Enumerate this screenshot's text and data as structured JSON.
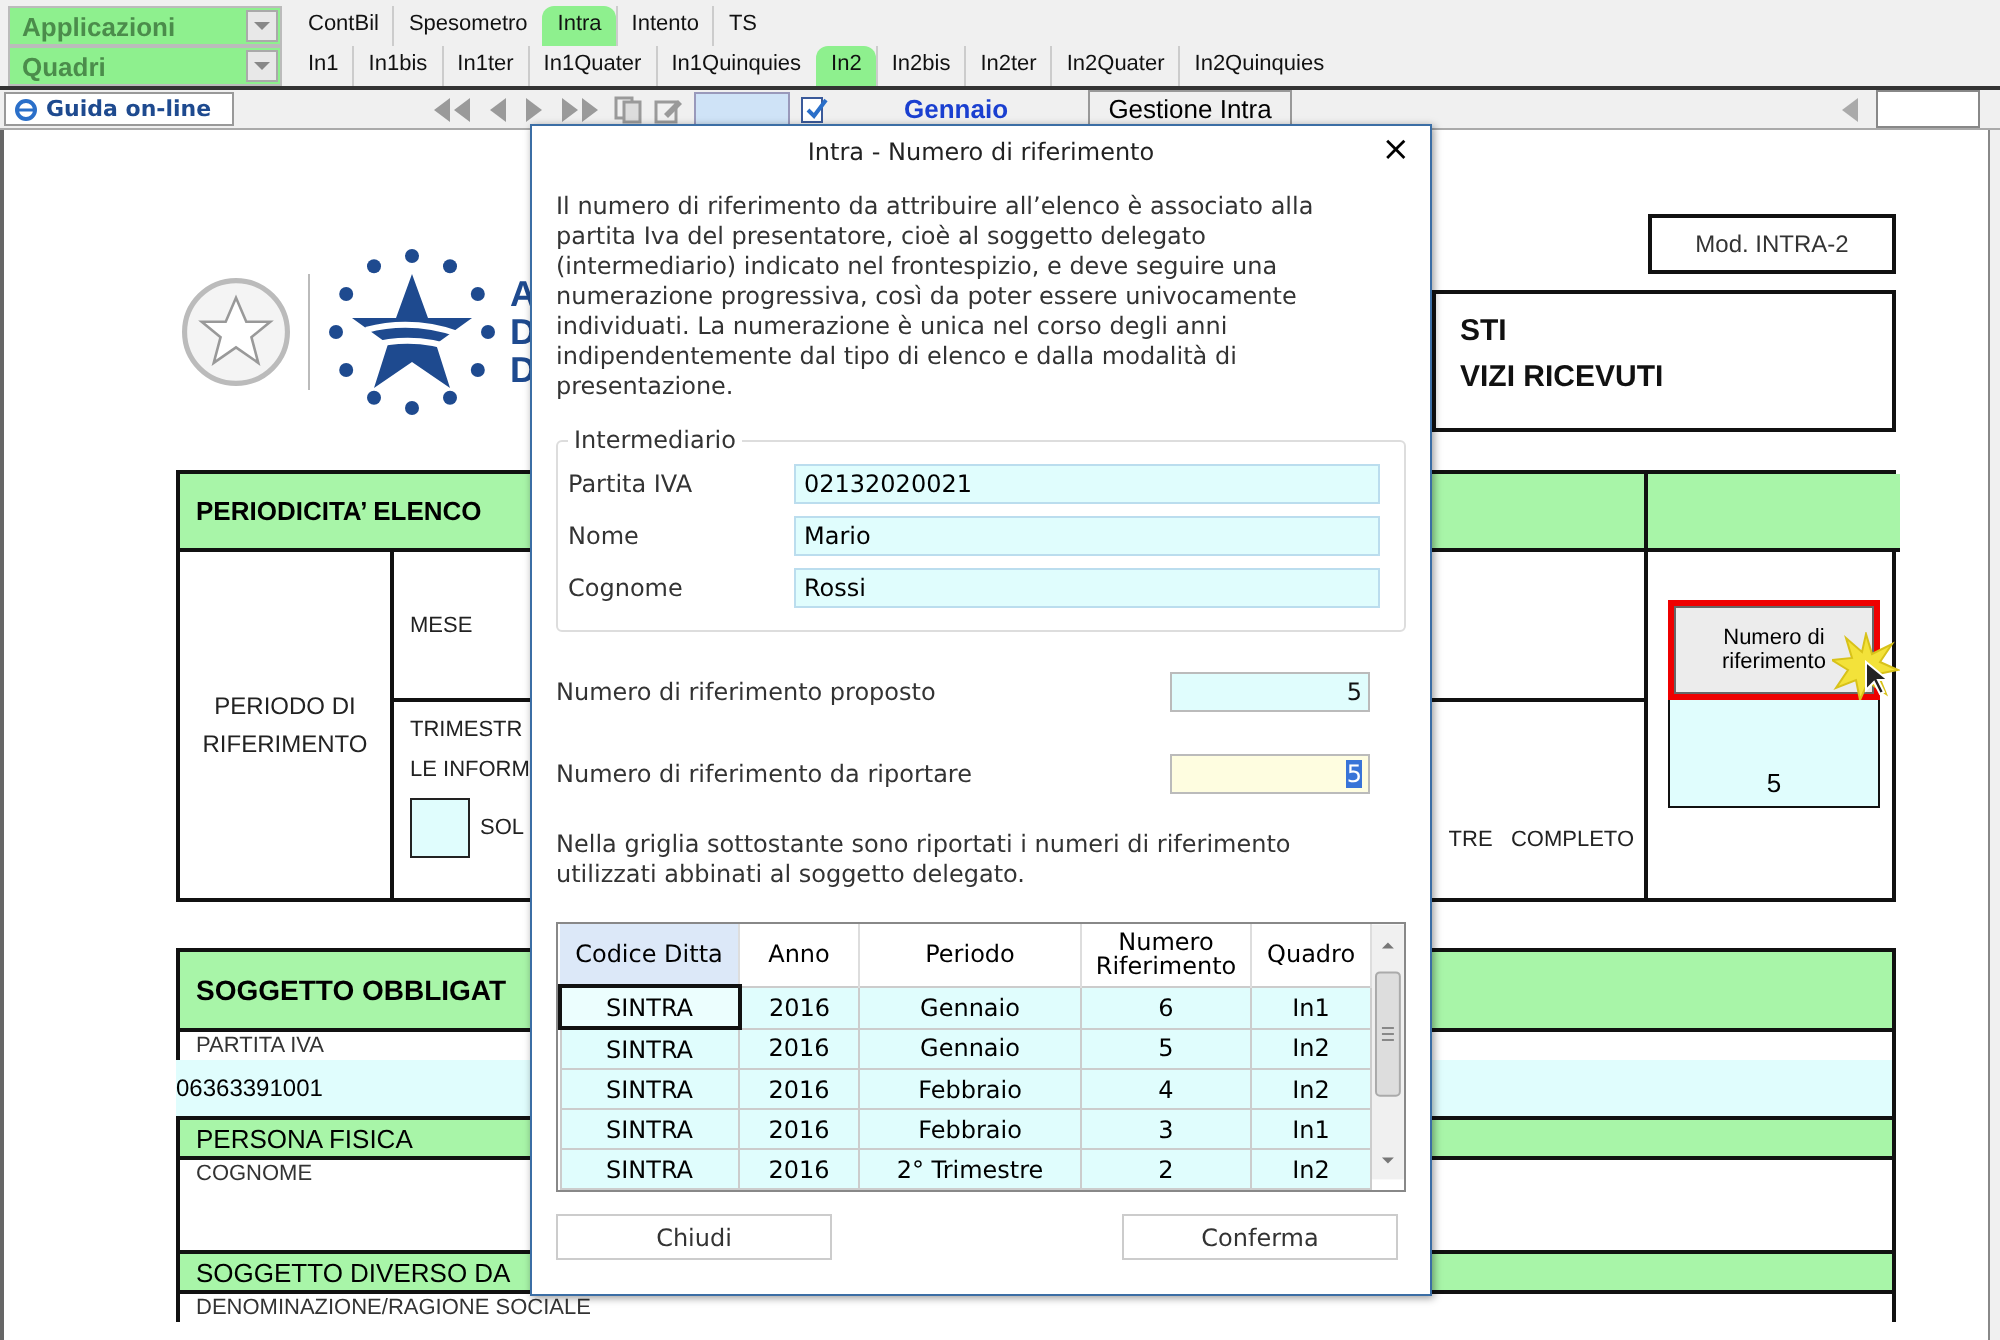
{
  "selectors": [
    {
      "label": "Applicazioni"
    },
    {
      "label": "Quadri"
    }
  ],
  "app_tabs": [
    {
      "label": "ContBil",
      "selected": false
    },
    {
      "label": "Spesometro",
      "selected": false
    },
    {
      "label": "Intra",
      "selected": true
    },
    {
      "label": "Intento",
      "selected": false
    },
    {
      "label": "TS",
      "selected": false
    }
  ],
  "quadri_tabs": [
    {
      "label": "In1",
      "selected": false
    },
    {
      "label": "In1bis",
      "selected": false
    },
    {
      "label": "In1ter",
      "selected": false
    },
    {
      "label": "In1Quater",
      "selected": false
    },
    {
      "label": "In1Quinquies",
      "selected": false
    },
    {
      "label": "In2",
      "selected": true
    },
    {
      "label": "In2bis",
      "selected": false
    },
    {
      "label": "In2ter",
      "selected": false
    },
    {
      "label": "In2Quater",
      "selected": false
    },
    {
      "label": "In2Quinquies",
      "selected": false
    }
  ],
  "toolbar": {
    "help_button": "Guida on-line",
    "month": "Gennaio",
    "section_button": "Gestione Intra"
  },
  "form": {
    "logo_letters": [
      "A",
      "D",
      "D"
    ],
    "model_label": "Mod. INTRA-2",
    "title_lines": [
      "STI",
      "VIZI RICEVUTI"
    ],
    "periodicity": {
      "header": "PERIODICITA’ ELENCO",
      "period_label": "PERIODO DI RIFERIMENTO",
      "month_label": "MESE",
      "quarter_label": "TRIMESTR",
      "info_label": "LE INFORM",
      "only_checkbox": {
        "label": "SOL",
        "checked": false
      },
      "complete_label": "TRE   COMPLETO",
      "reference_button": "Numero di riferimento",
      "reference_value": "5"
    },
    "obligated": {
      "header": "SOGGETTO OBBLIGAT",
      "vat_label": "PARTITA IVA",
      "vat_value": "06363391001",
      "person_header": "PERSONA FISICA",
      "surname_label": "COGNOME",
      "other_header": "SOGGETTO DIVERSO DA",
      "company_label": "DENOMINAZIONE/RAGIONE SOCIALE"
    }
  },
  "dialog": {
    "title": "Intra - Numero di riferimento",
    "close": "×",
    "intro": "Il numero di riferimento da attribuire all’elenco è associato alla partita Iva del presentatore, cioè al soggetto delegato (intermediario) indicato nel frontespizio, e deve seguire una numerazione progressiva, così da poter essere univocamente individuati. La numerazione è unica nel corso degli anni indipendentemente dal tipo di elenco e dalla modalità di presentazione.",
    "intermediary": {
      "legend": "Intermediario",
      "fields": [
        {
          "label": "Partita IVA",
          "value": "02132020021"
        },
        {
          "label": "Nome",
          "value": "Mario"
        },
        {
          "label": "Cognome",
          "value": "Rossi"
        }
      ]
    },
    "proposed": {
      "label": "Numero di riferimento proposto",
      "value": "5"
    },
    "to_report": {
      "label": "Numero di riferimento da riportare",
      "value": "5",
      "value_selected": true
    },
    "grid_note": "Nella griglia sottostante sono riportati i numeri di riferimento utilizzati abbinati al soggetto delegato.",
    "grid": {
      "columns": [
        "Codice Ditta",
        "Anno",
        "Periodo",
        "Numero Riferimento",
        "Quadro"
      ],
      "rows": [
        {
          "cells": [
            "SINTRA",
            "2016",
            "Gennaio",
            "6",
            "In1"
          ],
          "selected": true
        },
        {
          "cells": [
            "SINTRA",
            "2016",
            "Gennaio",
            "5",
            "In2"
          ],
          "selected": false
        },
        {
          "cells": [
            "SINTRA",
            "2016",
            "Febbraio",
            "4",
            "In2"
          ],
          "selected": false
        },
        {
          "cells": [
            "SINTRA",
            "2016",
            "Febbraio",
            "3",
            "In1"
          ],
          "selected": false
        },
        {
          "cells": [
            "SINTRA",
            "2016",
            "2° Trimestre",
            "2",
            "In2"
          ],
          "selected": false
        }
      ]
    },
    "buttons": [
      {
        "label": "Chiudi"
      },
      {
        "label": "Conferma"
      }
    ]
  }
}
